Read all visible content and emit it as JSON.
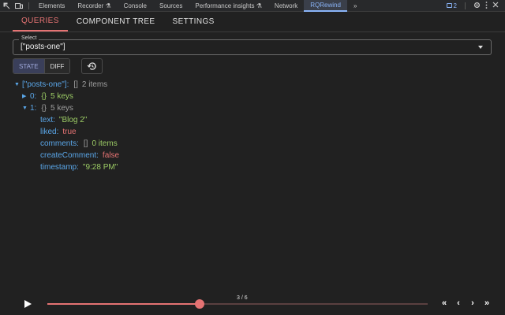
{
  "devtools": {
    "tabs": [
      "Elements",
      "Recorder ⚗",
      "Console",
      "Sources",
      "Performance insights ⚗",
      "Network",
      "RQRewind",
      "»"
    ],
    "active_tab": "RQRewind",
    "issues_count": "2"
  },
  "app_tabs": [
    {
      "label": "QUERIES",
      "active": true
    },
    {
      "label": "COMPONENT TREE",
      "active": false
    },
    {
      "label": "SETTINGS",
      "active": false
    }
  ],
  "select": {
    "label": "Select",
    "value": "[\"posts-one\"]"
  },
  "toggle": {
    "state": "STATE",
    "diff": "DIFF"
  },
  "tree": {
    "root": {
      "key": "[\"posts-one\"]:",
      "type": "[]",
      "count": "2 items"
    },
    "item0": {
      "key": "0:",
      "type": "{}",
      "count": "5 keys"
    },
    "item1": {
      "key": "1:",
      "type": "{}",
      "count": "5 keys"
    },
    "fields": {
      "text": {
        "key": "text:",
        "value": "\"Blog 2\""
      },
      "liked": {
        "key": "liked:",
        "value": "true"
      },
      "comments": {
        "key": "comments:",
        "type": "[]",
        "count": "0 items"
      },
      "createComment": {
        "key": "createComment:",
        "value": "false"
      },
      "timestamp": {
        "key": "timestamp:",
        "value": "\"9:28 PM\""
      }
    }
  },
  "player": {
    "step_label": "3 / 6",
    "progress": 0.4,
    "nav": [
      "«",
      "‹",
      "›",
      "»"
    ]
  },
  "colors": {
    "accent": "#e57373",
    "key_blue": "#5aa6e8",
    "string_green": "#9ccc65",
    "bool_red": "#e57373",
    "background": "#212121"
  }
}
